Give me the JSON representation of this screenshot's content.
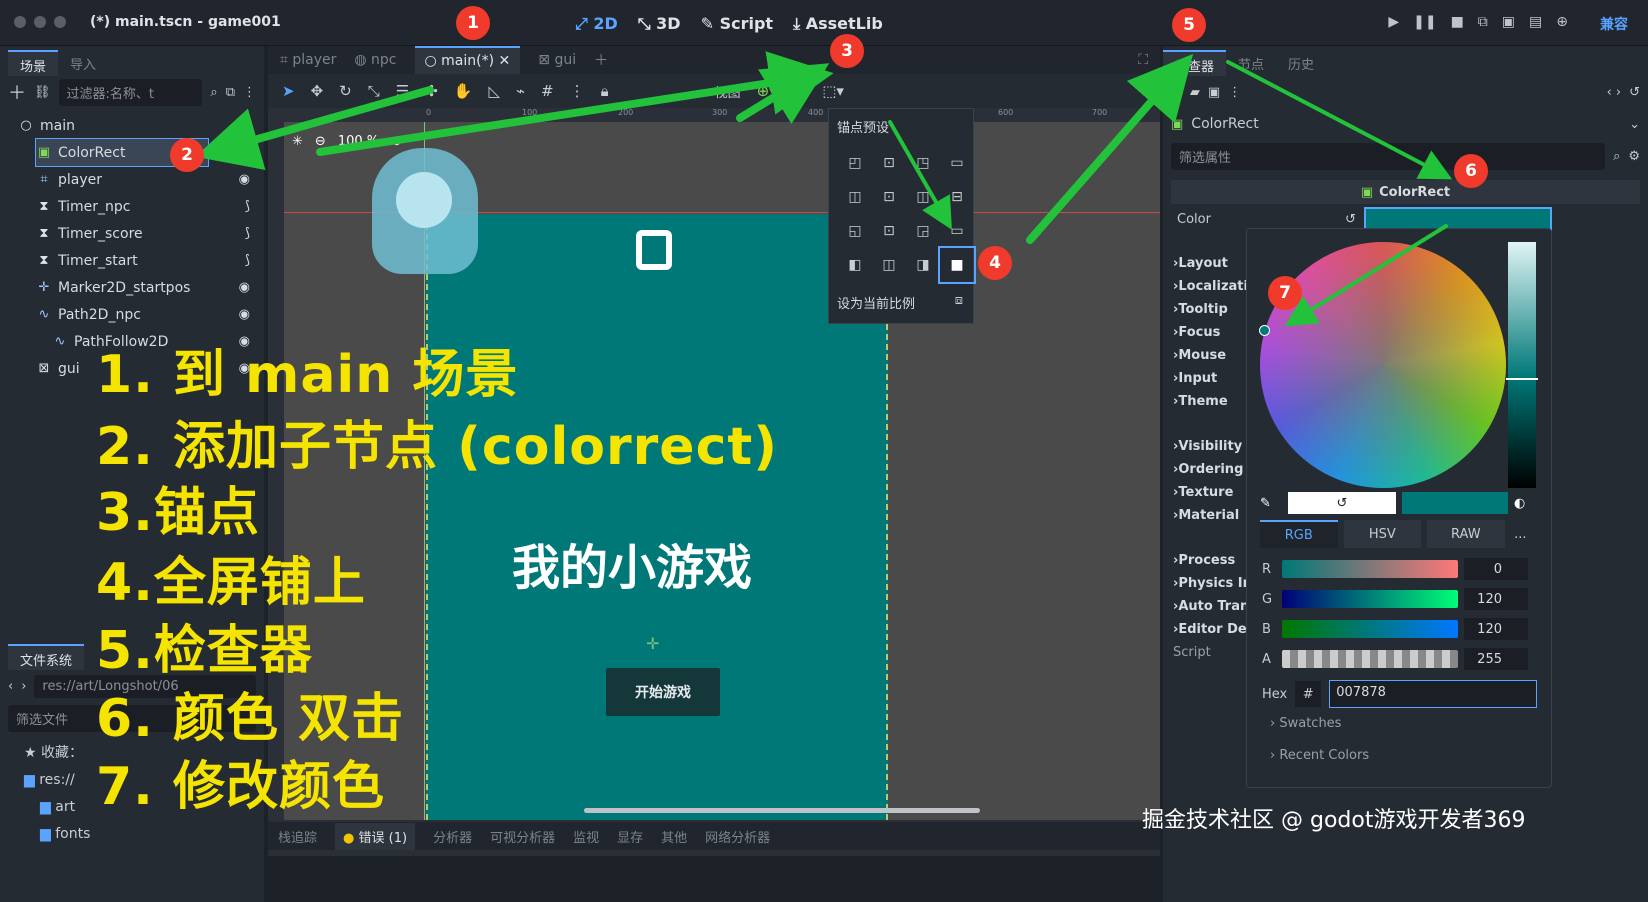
{
  "window": {
    "title": "(*) main.tscn - game001"
  },
  "main_modes": [
    "2D",
    "3D",
    "Script",
    "AssetLib"
  ],
  "compat_label": "兼容",
  "scene_dock": {
    "tabs": [
      "场景",
      "导入"
    ],
    "filter_placeholder": "过滤器:名称、t",
    "tree": [
      {
        "label": "main",
        "icon": "○"
      },
      {
        "label": "ColorRect",
        "icon": "▣"
      },
      {
        "label": "player",
        "icon": "⌗"
      },
      {
        "label": "Timer_npc",
        "icon": "⧗"
      },
      {
        "label": "Timer_score",
        "icon": "⧗"
      },
      {
        "label": "Timer_start",
        "icon": "⧗"
      },
      {
        "label": "Marker2D_startpos",
        "icon": "✛"
      },
      {
        "label": "Path2D_npc",
        "icon": "∿"
      },
      {
        "label": "PathFollow2D",
        "icon": "∿"
      },
      {
        "label": "gui",
        "icon": "⊠"
      }
    ]
  },
  "filesystem": {
    "title": "文件系统",
    "path": "res://art/Longshot/06",
    "filter_placeholder": "筛选文件",
    "favorites": "收藏：",
    "items": [
      "res://",
      "art",
      "fonts"
    ]
  },
  "editor_tabs": [
    "player",
    "npc",
    "main(*)",
    "gui"
  ],
  "viewport": {
    "zoom": "100 %",
    "view_label": "视图",
    "ruler_marks": [
      "0",
      "100",
      "200",
      "300",
      "400",
      "500",
      "600",
      "700"
    ],
    "game_title": "我的小游戏",
    "start_button": "开始游戏"
  },
  "anchor_popup": {
    "title": "锚点预设",
    "footer": "设为当前比例"
  },
  "bottom_tabs": [
    "栈追踪",
    "错误 (1)",
    "分析器",
    "可视分析器",
    "监视",
    "显存",
    "其他",
    "网络分析器"
  ],
  "inspector": {
    "tabs": [
      "检查器",
      "节点",
      "历史"
    ],
    "node_name": "ColorRect",
    "filter_placeholder": "筛选属性",
    "section": "ColorRect",
    "color_label": "Color",
    "color_value": "#007878",
    "groups": [
      "Layout",
      "Localizati",
      "Tooltip",
      "Focus",
      "Mouse",
      "Input",
      "Theme",
      "Visibility",
      "Ordering",
      "Texture",
      "Material",
      "Process",
      "Physics In",
      "Auto Tran",
      "Editor De"
    ],
    "script_label": "Script"
  },
  "color_picker": {
    "modes": [
      "RGB",
      "HSV",
      "RAW",
      "..."
    ],
    "channels": [
      {
        "name": "R",
        "value": "0"
      },
      {
        "name": "G",
        "value": "120"
      },
      {
        "name": "B",
        "value": "120"
      },
      {
        "name": "A",
        "value": "255"
      }
    ],
    "hex_label": "Hex",
    "hex_hash": "#",
    "hex_value": "007878",
    "swatches": "Swatches",
    "recent": "Recent Colors"
  },
  "overlay_steps": [
    "1. 到 main 场景",
    "2. 添加子节点 (colorrect)",
    "3.锚点",
    "4.全屏铺上",
    "5.检查器",
    "6. 颜色 双击",
    "7. 修改颜色"
  ],
  "badges": [
    "1",
    "2",
    "3",
    "4",
    "5",
    "6",
    "7"
  ],
  "watermark": "掘金技术社区 @ godot游戏开发者369",
  "colors": {
    "accent": "#5aa3ff",
    "teal": "#007878",
    "overlay_yellow": "#f5e400",
    "badge_red": "#f03a2c",
    "arrow_green": "#22c23a"
  }
}
